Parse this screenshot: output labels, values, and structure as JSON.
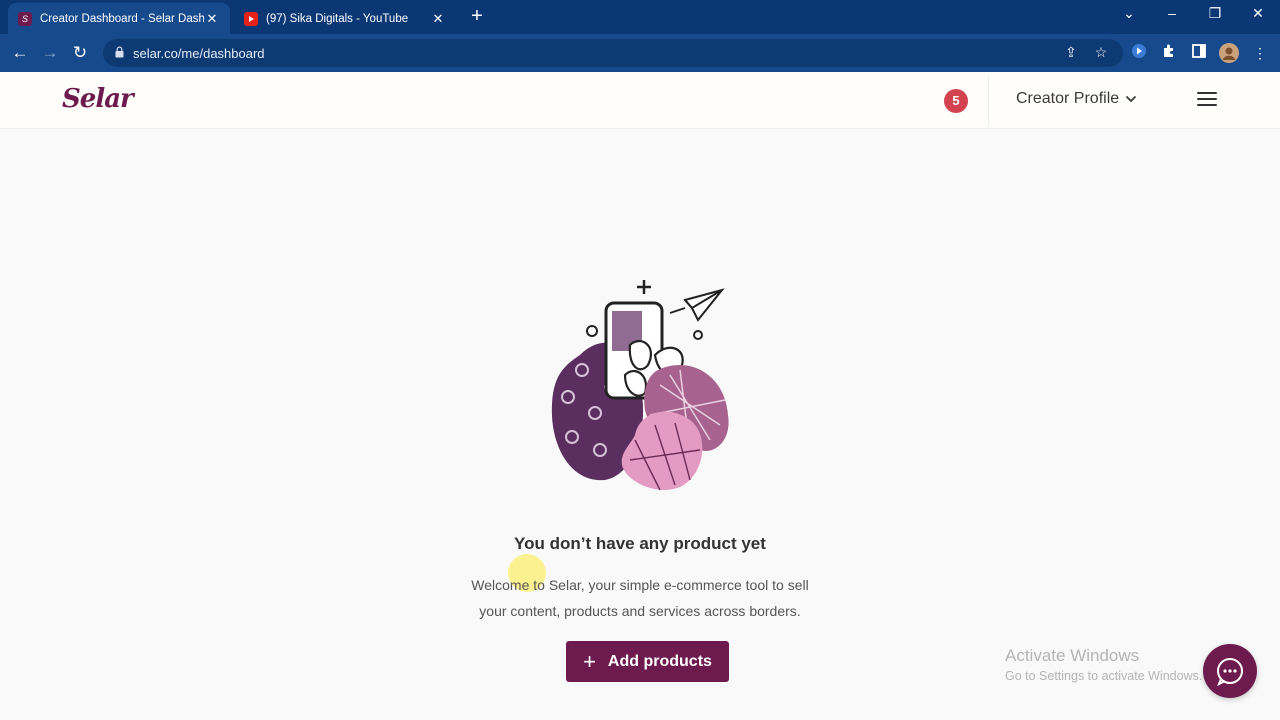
{
  "browser": {
    "tabs": [
      {
        "title": "Creator Dashboard - Selar Dashb",
        "active": true,
        "icon": "selar-favicon"
      },
      {
        "title": "(97) Sika Digitals - YouTube",
        "active": false,
        "icon": "youtube-favicon"
      }
    ],
    "url": "selar.co/me/dashboard"
  },
  "header": {
    "logo": "Selar",
    "notification_count": "5",
    "profile_label": "Creator Profile"
  },
  "empty_state": {
    "title": "You don’t have any product yet",
    "desc_line1": "Welcome to Selar, your simple e-commerce tool to sell",
    "desc_line2": "your content, products and services across borders.",
    "button_label": "Add products"
  },
  "watermark": {
    "line1": "Activate Windows",
    "line2": "Go to Settings to activate Windows."
  },
  "colors": {
    "brand": "#6d1b4e",
    "badge": "#d2434f",
    "browser_frame": "#0b3875"
  }
}
